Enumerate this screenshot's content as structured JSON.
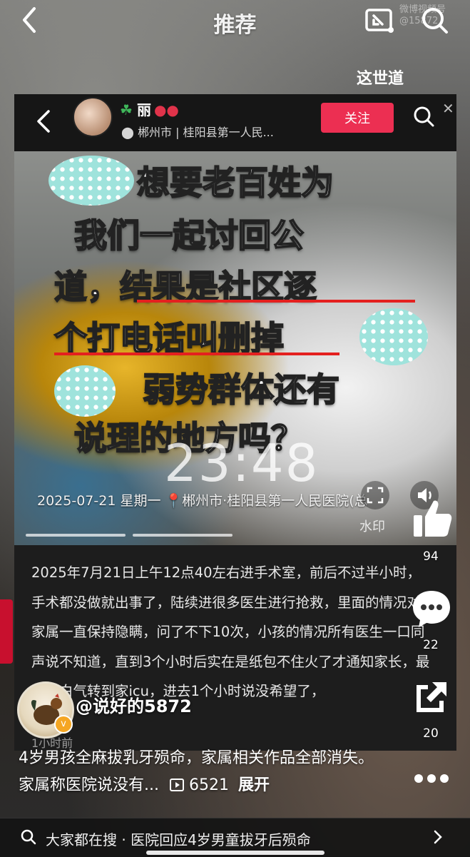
{
  "header": {
    "title": "推荐",
    "watermark": "微博视频号 @15872",
    "sub_caption": "这世道"
  },
  "card": {
    "user_name": "丽",
    "location": "郴州市 | 桂阳县第一人民...",
    "follow_label": "关注",
    "overlay_lines": [
      "想要老百姓为",
      "我们一起讨回公",
      "道，结果是社区逐",
      "个打电话叫删掉",
      "弱势群体还有",
      "说理的地方吗？"
    ],
    "time_overlay": "23:48",
    "stamp": "2025-07-21  星期一  📍郴州市·桂阳县第一人民医院(总",
    "watermark_label": "水印",
    "description": "2025年7月21日上午12点40左右进手术室，前后不过半小时，手术都没做就出事了，陆续进很多医生进行抢救，里面的情况对家属一直保持隐瞒，问了不下10次，小孩的情况所有医生一口同声说不知道，直到3个小时后实在是纸包不住火了才通知家长，最后一白气转到家icu，进去1个小时说没希望了，",
    "time_ago": "1小时前"
  },
  "rail": {
    "likes": "94",
    "comments": "22",
    "shares": "20"
  },
  "author": {
    "name": "@说好的5872"
  },
  "caption": {
    "text": "4岁男孩全麻拔乳牙殒命，家属相关作品全部消失。家属称医院说没有...",
    "play_count": "6521",
    "expand_label": "展开"
  },
  "search": {
    "text": "大家都在搜 · 医院回应4岁男童拔牙后殒命"
  },
  "colors": {
    "follow": "#ec2f52",
    "underline": "#e4201f",
    "redpacket_ring": "#f0a81e"
  }
}
